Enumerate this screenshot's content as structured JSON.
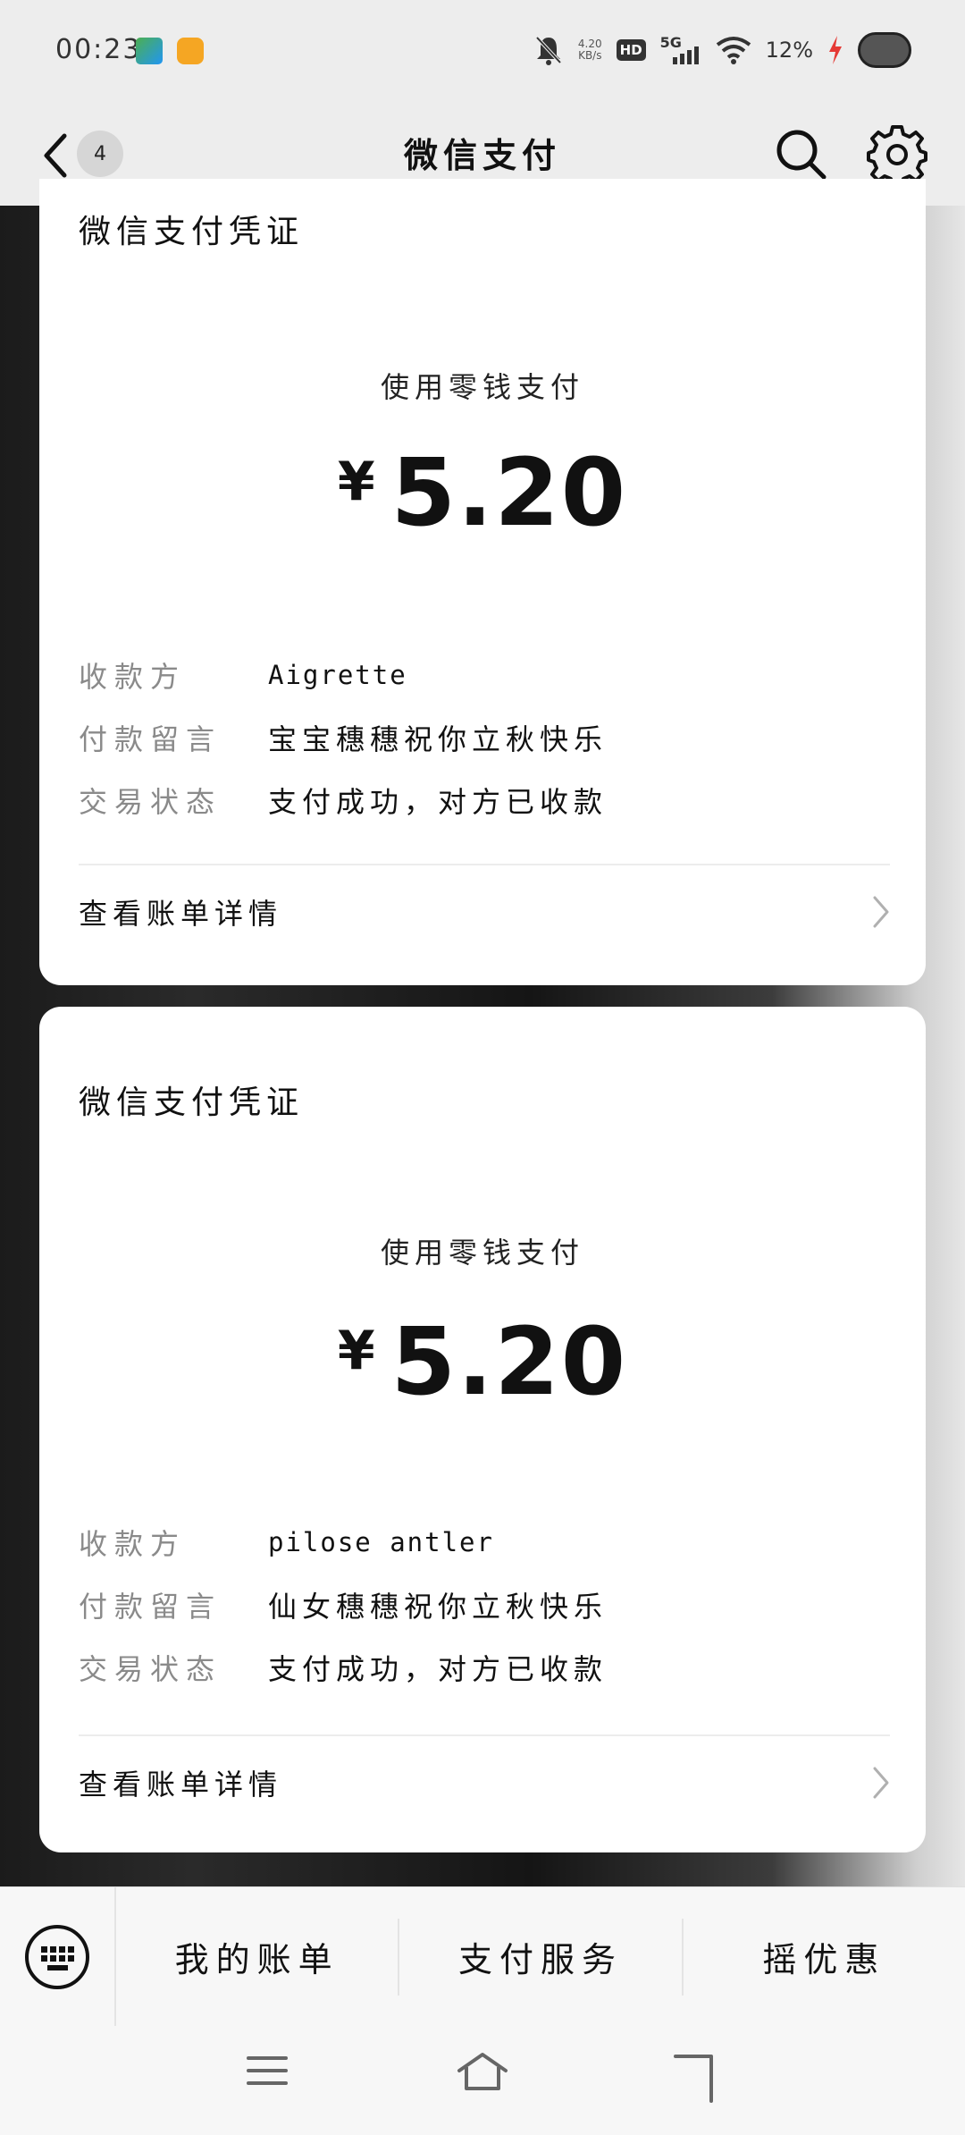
{
  "status_bar": {
    "time": "00:23",
    "net_speed_value": "4.20",
    "net_speed_unit": "KB/s",
    "hd": "HD",
    "network": "5G",
    "battery": "12%",
    "icons": [
      "image-app-icon",
      "weibo-icon",
      "mute-icon",
      "wifi-icon",
      "charging-icon"
    ]
  },
  "nav": {
    "badge": "4",
    "title": "微信支付"
  },
  "receipts": [
    {
      "title": "微信支付凭证",
      "method": "使用零钱支付",
      "currency": "¥",
      "amount": "5.20",
      "payee_label": "收款方",
      "payee": "Aigrette",
      "note_label": "付款留言",
      "note": "宝宝穗穗祝你立秋快乐",
      "status_label": "交易状态",
      "status": "支付成功，对方已收款",
      "bill_link": "查看账单详情"
    },
    {
      "title": "微信支付凭证",
      "method": "使用零钱支付",
      "currency": "¥",
      "amount": "5.20",
      "payee_label": "收款方",
      "payee": "pilose antler",
      "note_label": "付款留言",
      "note": "仙女穗穗祝你立秋快乐",
      "status_label": "交易状态",
      "status": "支付成功，对方已收款",
      "bill_link": "查看账单详情"
    }
  ],
  "bottom_menu": {
    "items": [
      "我的账单",
      "支付服务",
      "摇优惠"
    ]
  },
  "colors": {
    "background": "#ededed",
    "card": "#ffffff",
    "label_gray": "#8a8a8a",
    "charging_red": "#e53935"
  }
}
